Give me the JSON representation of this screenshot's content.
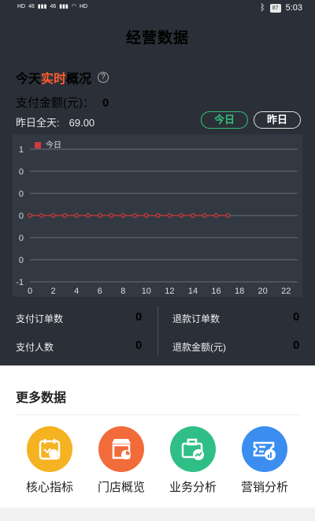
{
  "status_bar": {
    "left_indicators": [
      "HD",
      "46",
      "46",
      "HD"
    ],
    "battery": "87",
    "time": "5:03"
  },
  "header": {
    "title": "经营数据"
  },
  "realtime": {
    "title_prefix": "今天",
    "title_highlight": "实时",
    "title_suffix": "概况",
    "help_glyph": "?"
  },
  "summary": {
    "pay_label": "支付金额(元)：",
    "pay_value": "0",
    "yesterday_label": "昨日全天:",
    "yesterday_value": "69.00",
    "btn_today": "今日",
    "btn_yesterday": "昨日"
  },
  "chart_data": {
    "type": "line",
    "legend": [
      "今日"
    ],
    "y_tick_labels": [
      "1",
      "0",
      "0",
      "0",
      "0",
      "0",
      "-1"
    ],
    "x_tick_labels": [
      "0",
      "2",
      "4",
      "6",
      "8",
      "10",
      "12",
      "14",
      "16",
      "18",
      "20",
      "22"
    ],
    "x": [
      0,
      1,
      2,
      3,
      4,
      5,
      6,
      7,
      8,
      9,
      10,
      11,
      12,
      13,
      14,
      15,
      16,
      17
    ],
    "series": [
      {
        "name": "今日",
        "values": [
          0,
          0,
          0,
          0,
          0,
          0,
          0,
          0,
          0,
          0,
          0,
          0,
          0,
          0,
          0,
          0,
          0,
          0
        ]
      }
    ],
    "xlim": [
      0,
      23
    ],
    "ylim": [
      -1,
      1
    ],
    "colors": {
      "series": "#d23a3a",
      "grid": "#6a7079"
    }
  },
  "stats": {
    "order_count_label": "支付订单数",
    "order_count_value": "0",
    "refund_order_label": "退款订单数",
    "refund_order_value": "0",
    "payer_count_label": "支付人数",
    "payer_count_value": "0",
    "refund_amount_label": "退款金额(元)",
    "refund_amount_value": "0"
  },
  "more": {
    "title": "更多数据",
    "items": [
      {
        "label": "核心指标",
        "icon": "calendar-chart-icon",
        "color": "#f5b221"
      },
      {
        "label": "门店概览",
        "icon": "store-icon",
        "color": "#f26b3a"
      },
      {
        "label": "业务分析",
        "icon": "briefcase-chart-icon",
        "color": "#2fbf86"
      },
      {
        "label": "营销分析",
        "icon": "ticket-chart-icon",
        "color": "#3b8ef0"
      }
    ]
  }
}
